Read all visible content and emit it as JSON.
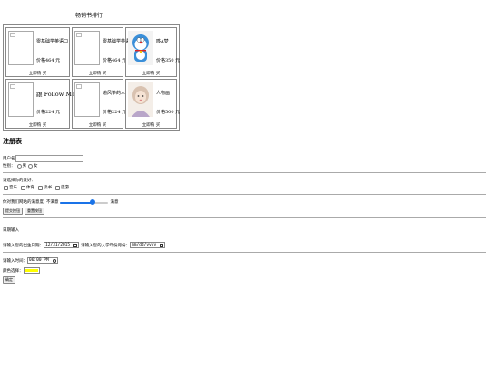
{
  "page_title": "畅销书排行",
  "books": [
    {
      "name": "零基础学英语口",
      "price": "价格464 元",
      "buy": "立即购 买",
      "image": "broken"
    },
    {
      "name": "零基础学英语口",
      "price": "价格464 元",
      "buy": "立即购 买",
      "image": "broken"
    },
    {
      "name": "哆A梦",
      "price": "价格350 元",
      "buy": "立即购 买",
      "image": "doraemon"
    },
    {
      "name": "跟 Follow Me",
      "price": "价格224 元",
      "buy": "立即购 买",
      "image": "broken"
    },
    {
      "name": "追风筝的人",
      "price": "价格224 元",
      "buy": "立即购 买",
      "image": "broken"
    },
    {
      "name": "人物画",
      "price": "价格500 元",
      "buy": "立即购 买",
      "image": "portrait"
    }
  ],
  "form_heading": "注册表",
  "username": {
    "label": "用户名",
    "value": ""
  },
  "gender": {
    "label": "性别：",
    "options": [
      "男",
      "女"
    ]
  },
  "hobbies": {
    "label": "请选择你的爱好：",
    "options": [
      "音乐",
      "体育",
      "读书",
      "旅游"
    ]
  },
  "satisfaction": {
    "label_left": "你对我们网站的满意度: 不满意",
    "label_right": "满意",
    "value": 0.68
  },
  "buttons": {
    "submit": "提交按钮",
    "reset": "重置按钮"
  },
  "date_section": {
    "heading": "日期输入",
    "date_label": "请输入您的出生日期：",
    "date_value": "12/31/2015",
    "month_label": "请输入您的入学年份月份：",
    "month_value": "mm/dd/yyyy"
  },
  "time": {
    "label": "请输入时间：",
    "value": "06:00 PM"
  },
  "color": {
    "label": "颜色选择：",
    "value": "#ffff00"
  },
  "ok_button": "确定"
}
